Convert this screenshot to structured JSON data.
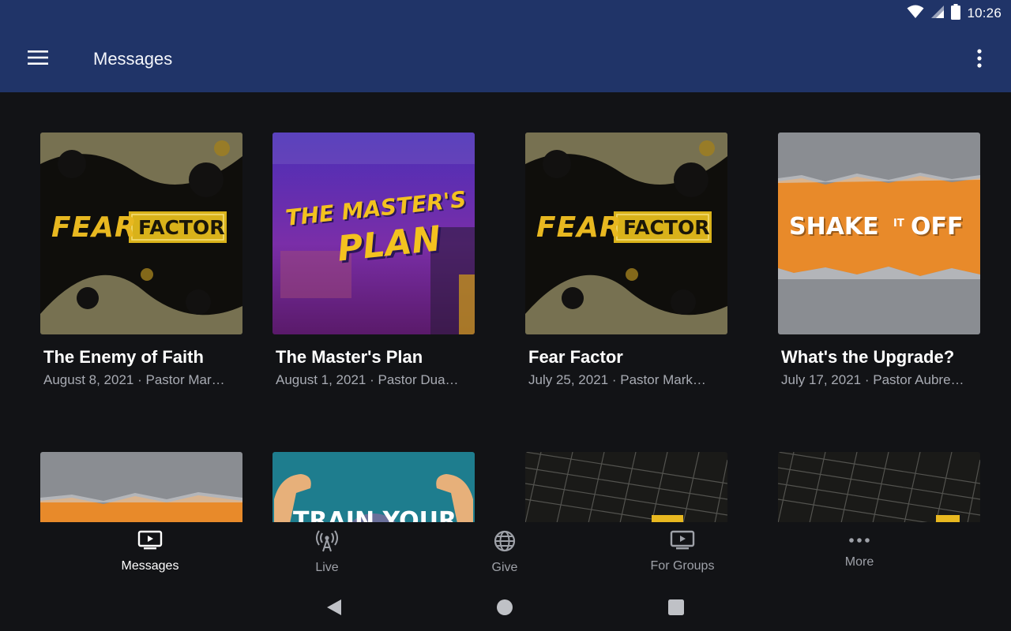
{
  "status_bar": {
    "time": "10:26"
  },
  "app_bar": {
    "title": "Messages"
  },
  "cards": [
    {
      "title": "The Enemy of Faith",
      "subtitle": "August 8, 2021 · Pastor Mar…",
      "art_text_1": "FEAR",
      "art_text_2": "FACTOR"
    },
    {
      "title": "The Master's Plan",
      "subtitle": "August 1, 2021 · Pastor Dua…",
      "art_text_1": "THE MASTER'S",
      "art_text_2": "PLAN"
    },
    {
      "title": "Fear Factor",
      "subtitle": "July 25, 2021 · Pastor Mark…",
      "art_text_1": "FEAR",
      "art_text_2": "FACTOR"
    },
    {
      "title": "What's the Upgrade?",
      "subtitle": "July 17, 2021 · Pastor Aubre…",
      "art_text_1": "SHAKE",
      "art_text_2": "IT",
      "art_text_3": "OFF"
    },
    {
      "title": "",
      "subtitle": ""
    },
    {
      "title": "",
      "subtitle": "",
      "art_text_1": "TRAIN YOUR"
    },
    {
      "title": "",
      "subtitle": ""
    },
    {
      "title": "",
      "subtitle": ""
    }
  ],
  "bottom_nav": [
    {
      "label": "Messages",
      "icon": "tv-play-icon",
      "active": true
    },
    {
      "label": "Live",
      "icon": "broadcast-icon"
    },
    {
      "label": "Give",
      "icon": "globe-icon"
    },
    {
      "label": "For Groups",
      "icon": "tv-play-icon"
    },
    {
      "label": "More",
      "icon": "more-horizontal-icon"
    }
  ],
  "colors": {
    "app_bar": "#203468",
    "background": "#121316",
    "subtitle": "#a8abb3",
    "nav_inactive": "#9ea1a8"
  }
}
